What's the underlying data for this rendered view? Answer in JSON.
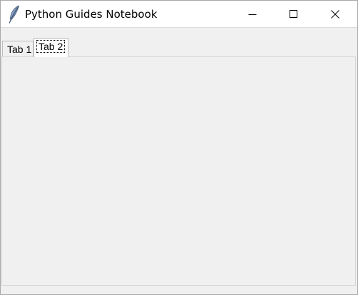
{
  "window": {
    "title": "Python Guides Notebook",
    "app_icon": "feather-icon",
    "controls": {
      "minimize_icon": "minimize-icon",
      "maximize_icon": "maximize-icon",
      "close_icon": "close-icon"
    }
  },
  "notebook": {
    "tabs": [
      {
        "label": "Tab 1",
        "selected": false
      },
      {
        "label": "Tab 2",
        "selected": true,
        "focused": true
      }
    ]
  },
  "colors": {
    "titlebar_bg": "#ffffff",
    "window_bg": "#f0f0f0",
    "selected_tab_bg": "#ffffff",
    "border": "#bdbdbd"
  }
}
